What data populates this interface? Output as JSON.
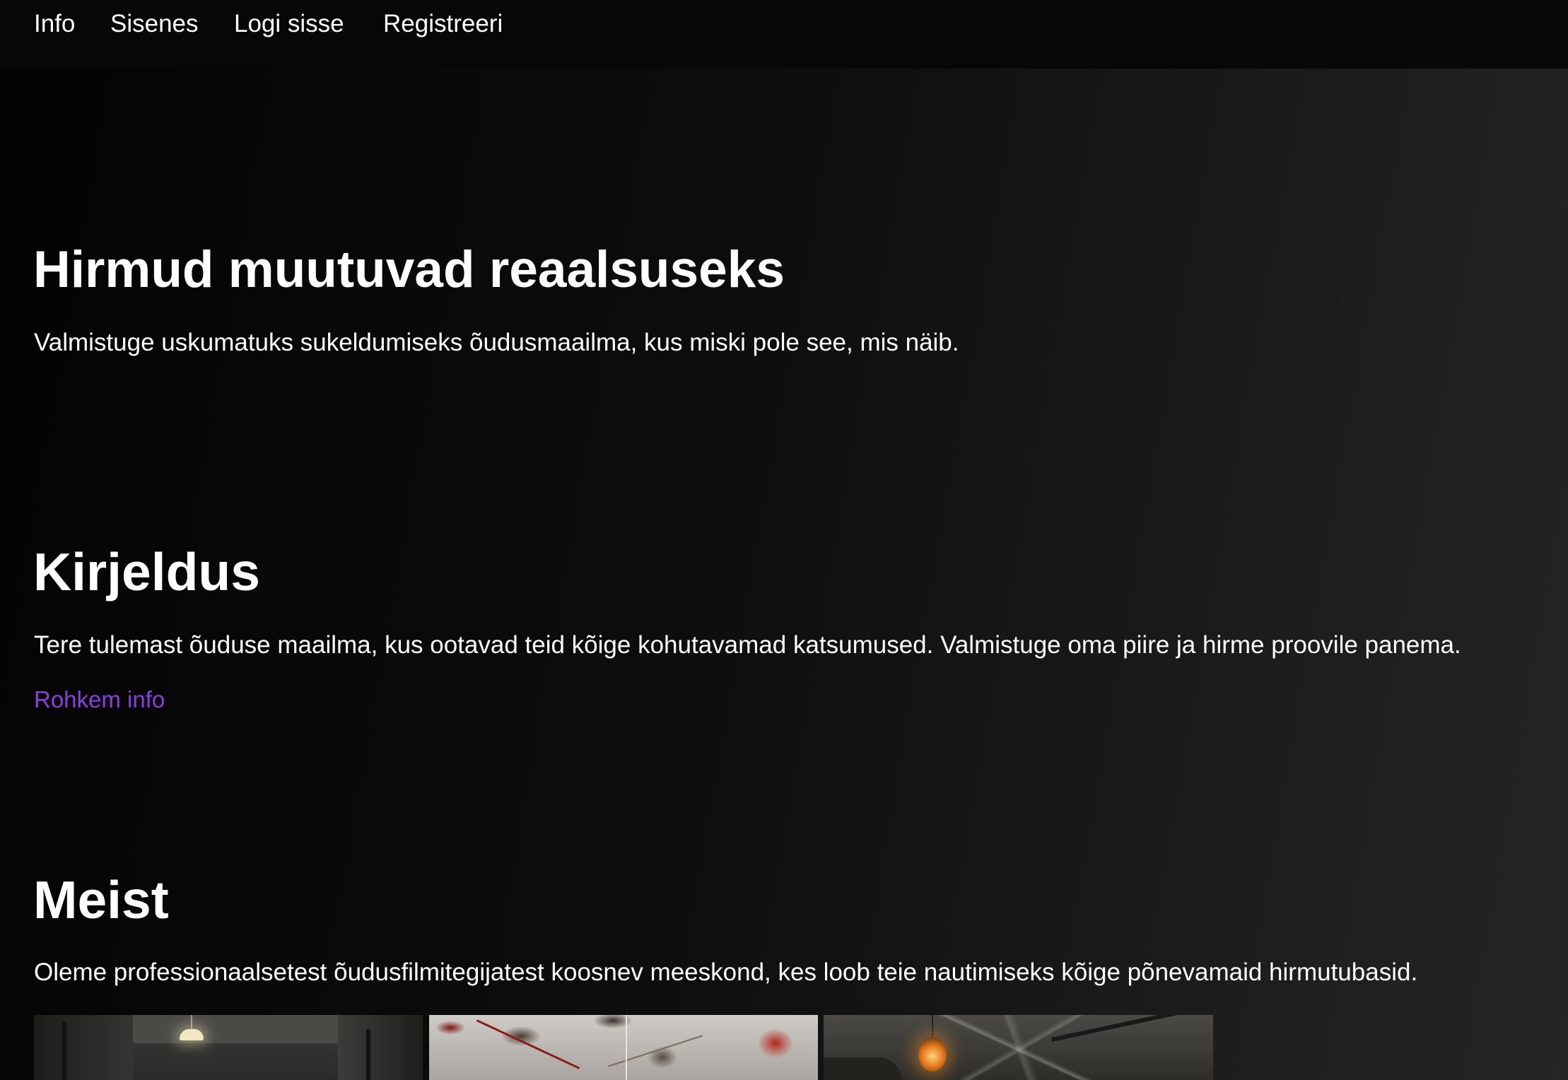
{
  "nav": {
    "items": [
      {
        "label": "Info"
      },
      {
        "label": "Sisenes"
      },
      {
        "label": "Logi sisse"
      },
      {
        "label": "Registreeri"
      }
    ]
  },
  "hero": {
    "title": "Hirmud muutuvad reaalsuseks",
    "text": "Valmistuge uskumatuks sukeldumiseks õudusmaailma, kus miski pole see, mis näib."
  },
  "kirjeldus": {
    "title": "Kirjeldus",
    "text": "Tere tulemast õuduse maailma, kus ootavad teid kõige kohutavamad katsumused. Valmistuge oma piire ja hirme proovile panema.",
    "link_label": "Rohkem info"
  },
  "meist": {
    "title": "Meist",
    "text": "Oleme professionaalsetest õudusfilmitegijatest koosnev meeskond, kes loob teie nautimiseks kõige põnevamaid hirmutubasid."
  },
  "colors": {
    "link": "#8a3fe0",
    "navbar": "#070707",
    "text": "#ffffff"
  }
}
